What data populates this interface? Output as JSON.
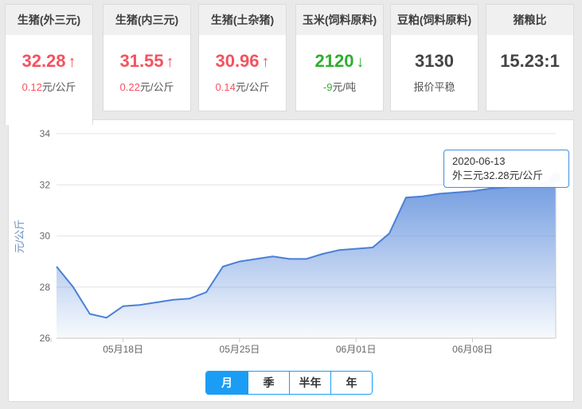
{
  "cards": [
    {
      "title": "生猪(外三元)",
      "value": "32.28",
      "arrow": "↑",
      "delta": "0.12",
      "unit": "元/公斤"
    },
    {
      "title": "生猪(内三元)",
      "value": "31.55",
      "arrow": "↑",
      "delta": "0.22",
      "unit": "元/公斤"
    },
    {
      "title": "生猪(土杂猪)",
      "value": "30.96",
      "arrow": "↑",
      "delta": "0.14",
      "unit": "元/公斤"
    },
    {
      "title": "玉米(饲料原料)",
      "value": "2120",
      "arrow": "↓",
      "delta": "-9",
      "unit": "元/吨"
    },
    {
      "title": "豆粕(饲料原料)",
      "value": "3130",
      "arrow": "",
      "delta": "",
      "unit": "报价平稳"
    },
    {
      "title": "猪粮比",
      "value": "15.23:1",
      "arrow": "",
      "delta": "",
      "unit": ""
    }
  ],
  "chart_data": {
    "type": "area",
    "title": "",
    "ylabel": "元/公斤",
    "ylim": [
      26,
      34
    ],
    "yticks": [
      26,
      28,
      30,
      32,
      34
    ],
    "start_date": "2020-05-14",
    "end_date": "2020-06-13",
    "values": [
      28.8,
      28.0,
      26.95,
      26.8,
      27.25,
      27.3,
      27.4,
      27.5,
      27.55,
      27.8,
      28.8,
      29.0,
      29.1,
      29.2,
      29.1,
      29.1,
      29.3,
      29.45,
      29.5,
      29.55,
      30.1,
      31.5,
      31.55,
      31.65,
      31.7,
      31.75,
      31.85,
      31.9,
      31.95,
      32.0,
      32.28
    ],
    "xtick_labels": [
      "05月18日",
      "05月25日",
      "06月01日",
      "06月08日"
    ],
    "xtick_indices": [
      4,
      11,
      18,
      25
    ],
    "grid": true,
    "series_name": "外三元",
    "tooltip": {
      "line1": "2020-06-13",
      "line2": "外三元32.28元/公斤"
    }
  },
  "period_tabs": [
    {
      "label": "月",
      "active": true
    },
    {
      "label": "季",
      "active": false
    },
    {
      "label": "半年",
      "active": false
    },
    {
      "label": "年",
      "active": false
    }
  ],
  "colors": {
    "up_red": "#f5525f",
    "down_green": "#2fae2f",
    "neutral_dark": "#444444",
    "tab_blue": "#1b9df5",
    "line_blue": "#4a80d6",
    "dot_blue": "#4a7fd9",
    "axis_text": "#666666",
    "grid_line": "#e4e4e4",
    "ylabel_blue": "#6d8fc0",
    "tooltip_border": "#4090e2"
  }
}
